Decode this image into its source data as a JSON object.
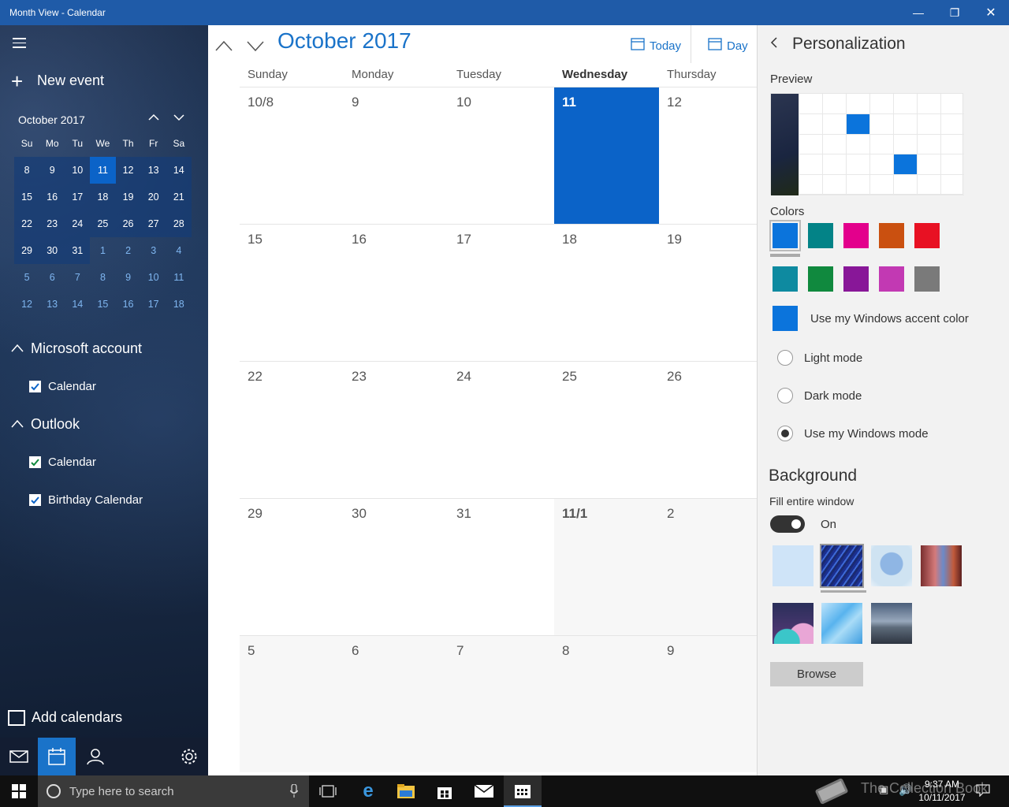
{
  "window": {
    "title": "Month View - Calendar"
  },
  "sidebar": {
    "new_event": "New event",
    "mini": {
      "title": "October 2017",
      "dow": [
        "Su",
        "Mo",
        "Tu",
        "We",
        "Th",
        "Fr",
        "Sa"
      ],
      "weeks": [
        [
          "8",
          "9",
          "10",
          "11",
          "12",
          "13",
          "14"
        ],
        [
          "15",
          "16",
          "17",
          "18",
          "19",
          "20",
          "21"
        ],
        [
          "22",
          "23",
          "24",
          "25",
          "26",
          "27",
          "28"
        ],
        [
          "29",
          "30",
          "31",
          "1",
          "2",
          "3",
          "4"
        ],
        [
          "5",
          "6",
          "7",
          "8",
          "9",
          "10",
          "11"
        ],
        [
          "12",
          "13",
          "14",
          "15",
          "16",
          "17",
          "18"
        ]
      ],
      "selected": "11"
    },
    "groups": [
      {
        "name": "Microsoft account",
        "items": [
          "Calendar"
        ]
      },
      {
        "name": "Outlook",
        "items": [
          "Calendar",
          "Birthday Calendar"
        ]
      }
    ],
    "add_calendars": "Add calendars"
  },
  "main": {
    "month_title": "October 2017",
    "today_label": "Today",
    "view_label": "Day",
    "days": [
      "Sunday",
      "Monday",
      "Tuesday",
      "Wednesday",
      "Thursday"
    ],
    "weeks": [
      [
        "10/8",
        "9",
        "10",
        "11",
        "12"
      ],
      [
        "15",
        "16",
        "17",
        "18",
        "19"
      ],
      [
        "22",
        "23",
        "24",
        "25",
        "26"
      ],
      [
        "29",
        "30",
        "31",
        "11/1",
        "2"
      ],
      [
        "5",
        "6",
        "7",
        "8",
        "9"
      ]
    ]
  },
  "panel": {
    "title": "Personalization",
    "preview_label": "Preview",
    "colors_label": "Colors",
    "colors": [
      "#0b74dc",
      "#038387",
      "#e3008c",
      "#ca5010",
      "#e81123",
      "#0e8aa0",
      "#10893e",
      "#881798",
      "#c239b3",
      "#7a7a7a"
    ],
    "accent_label": "Use my Windows accent color",
    "modes": [
      "Light mode",
      "Dark mode",
      "Use my Windows mode"
    ],
    "selected_mode": "Use my Windows mode",
    "background_label": "Background",
    "fill_label": "Fill entire window",
    "toggle_state": "On",
    "browse_label": "Browse"
  },
  "taskbar": {
    "search_placeholder": "Type here to search",
    "time": "9:37 AM",
    "date": "10/11/2017",
    "watermark": "The Collection Book"
  }
}
